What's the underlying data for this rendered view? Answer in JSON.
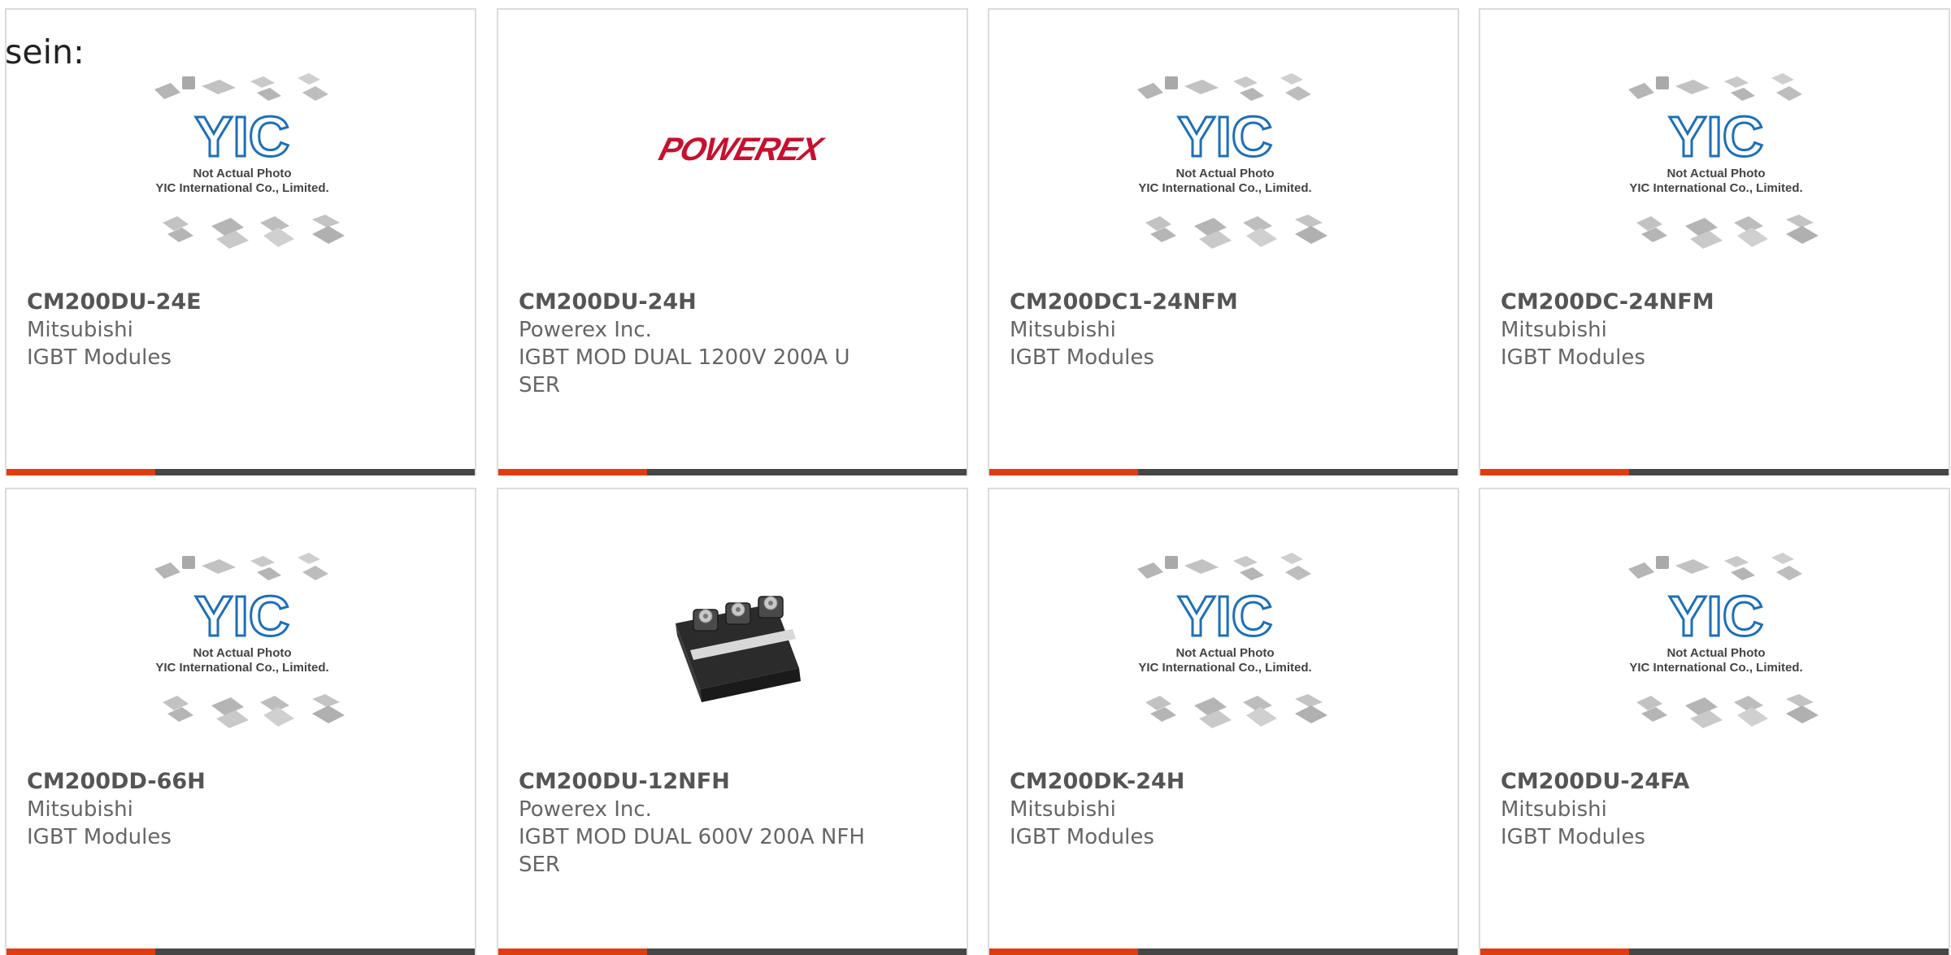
{
  "heading": "sein:",
  "placeholder": {
    "line1": "Not Actual Photo",
    "line2": "YIC International Co., Limited.",
    "logo_text": "YIC"
  },
  "powerex_logo": "POWEREX",
  "colors": {
    "accent": "#e03c0f",
    "bar": "#464646",
    "border": "#dcdcdc",
    "part_text": "#555555",
    "body_text": "#666666",
    "logo_blue": "#1e6fb8",
    "powerex_red": "#c8102e"
  },
  "products": [
    {
      "part": "CM200DU-24E",
      "maker": "Mitsubishi",
      "desc": "IGBT Modules",
      "image": "yic-placeholder"
    },
    {
      "part": "CM200DU-24H",
      "maker": "Powerex Inc.",
      "desc": "IGBT MOD DUAL 1200V 200A U SER",
      "image": "powerex-logo"
    },
    {
      "part": "CM200DC1-24NFM",
      "maker": "Mitsubishi",
      "desc": "IGBT Modules",
      "image": "yic-placeholder"
    },
    {
      "part": "CM200DC-24NFM",
      "maker": "Mitsubishi",
      "desc": "IGBT Modules",
      "image": "yic-placeholder"
    },
    {
      "part": "CM200DD-66H",
      "maker": "Mitsubishi",
      "desc": "IGBT Modules",
      "image": "yic-placeholder"
    },
    {
      "part": "CM200DU-12NFH",
      "maker": "Powerex Inc.",
      "desc": "IGBT MOD DUAL 600V 200A NFH SER",
      "image": "igbt-module-photo"
    },
    {
      "part": "CM200DK-24H",
      "maker": "Mitsubishi",
      "desc": "IGBT Modules",
      "image": "yic-placeholder"
    },
    {
      "part": "CM200DU-24FA",
      "maker": "Mitsubishi",
      "desc": "IGBT Modules",
      "image": "yic-placeholder"
    }
  ]
}
